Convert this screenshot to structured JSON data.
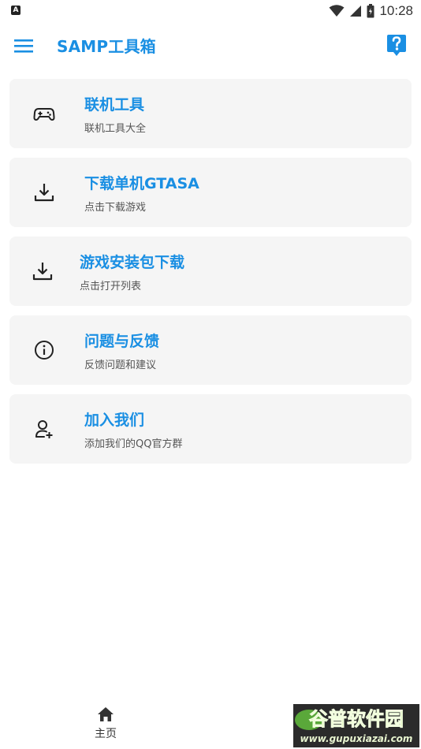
{
  "status_bar": {
    "time": "10:28",
    "left_icon_label": "A",
    "icons": [
      "notification-a-icon",
      "wifi-icon",
      "signal-icon",
      "battery-icon"
    ]
  },
  "app_bar": {
    "title": "SAMP工具箱",
    "menu_icon": "hamburger-menu-icon",
    "help_icon": "help-question-icon"
  },
  "cards": [
    {
      "icon": "gamepad-icon",
      "title": "联机工具",
      "subtitle": "联机工具大全"
    },
    {
      "icon": "download-icon",
      "title": "下载单机GTASA",
      "subtitle": "点击下载游戏"
    },
    {
      "icon": "download-icon",
      "title": "游戏安装包下载",
      "subtitle": "点击打开列表"
    },
    {
      "icon": "info-icon",
      "title": "问题与反馈",
      "subtitle": "反馈问题和建议"
    },
    {
      "icon": "add-user-icon",
      "title": "加入我们",
      "subtitle": "添加我们的QQ官方群"
    }
  ],
  "bottom_nav": {
    "items": [
      {
        "icon": "home-icon",
        "label": "主页"
      }
    ]
  },
  "watermark": {
    "brand": "谷普软件园",
    "url": "www.gupuxiazai.com"
  },
  "colors": {
    "accent": "#1a8fe3",
    "card_background": "#f5f5f5",
    "subtitle": "#555555"
  }
}
